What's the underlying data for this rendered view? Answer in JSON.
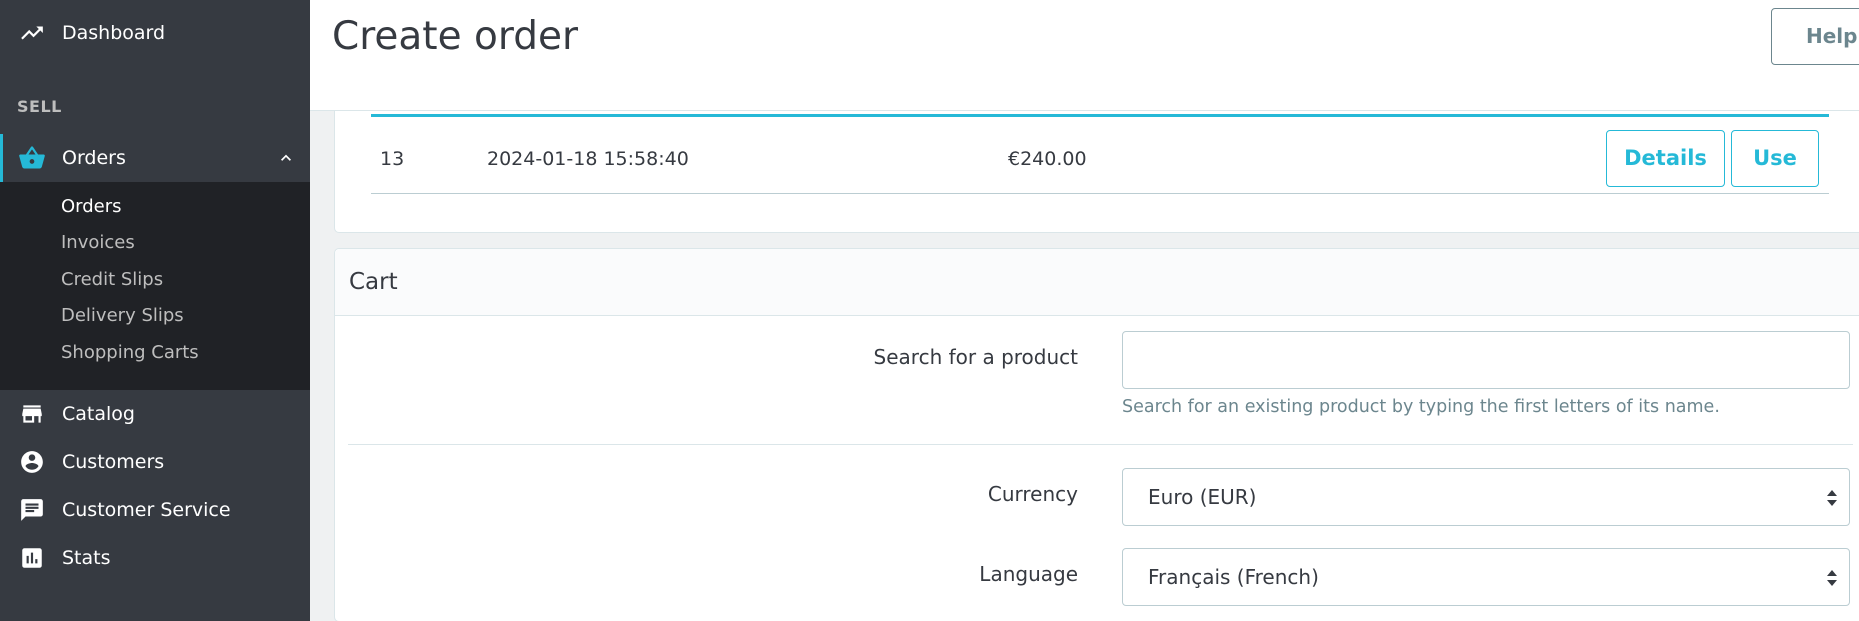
{
  "sidebar": {
    "dashboard": "Dashboard",
    "section_sell": "SELL",
    "orders": "Orders",
    "orders_sub": [
      "Orders",
      "Invoices",
      "Credit Slips",
      "Delivery Slips",
      "Shopping Carts"
    ],
    "catalog": "Catalog",
    "customers": "Customers",
    "customer_service": "Customer Service",
    "stats": "Stats"
  },
  "header": {
    "title": "Create order",
    "help": "Help"
  },
  "cart_row": {
    "id": "13",
    "date": "2024-01-18 15:58:40",
    "total": "€240.00",
    "details": "Details",
    "use": "Use"
  },
  "cart_section": {
    "title": "Cart",
    "search_label": "Search for a product",
    "search_value": "",
    "search_help": "Search for an existing product by typing the first letters of its name.",
    "currency_label": "Currency",
    "currency_value": "Euro (EUR)",
    "language_label": "Language",
    "language_value": "Français (French)"
  },
  "colors": {
    "sidebar_bg": "#363a41",
    "submenu_bg": "#202226",
    "accent": "#25b9d7"
  }
}
